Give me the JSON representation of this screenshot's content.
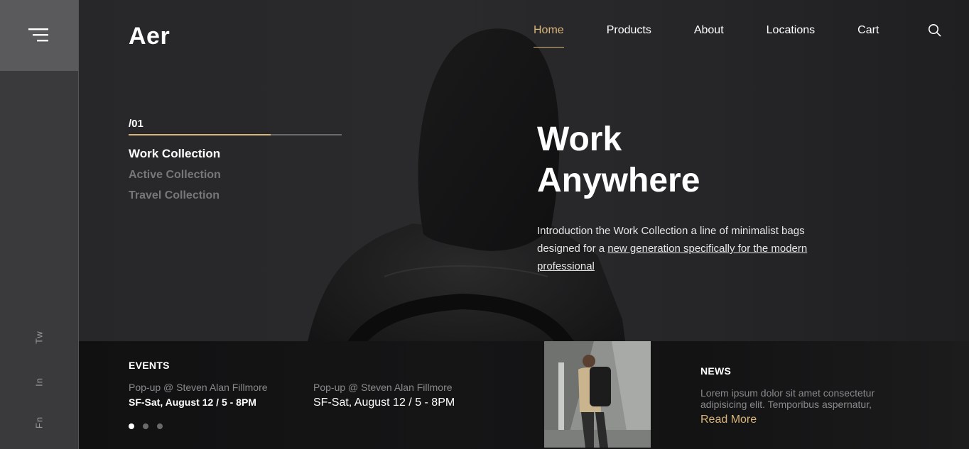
{
  "brand": "Aer",
  "nav": {
    "items": [
      {
        "label": "Home",
        "active": true
      },
      {
        "label": "Products",
        "active": false
      },
      {
        "label": "About",
        "active": false
      },
      {
        "label": "Locations",
        "active": false
      },
      {
        "label": "Cart",
        "active": false
      }
    ]
  },
  "social": {
    "twitter": "Tw",
    "linkedin": "In",
    "facebook": "Fn"
  },
  "slider": {
    "number": "/01",
    "progress_fraction": 0.667,
    "collections": [
      "Work Collection",
      "Active Collection",
      "Travel Collection"
    ],
    "active_index": 0
  },
  "hero": {
    "headline_line1": "Work",
    "headline_line2": "Anywhere",
    "intro_plain": "Introduction the Work Collection a line of minimalist bags designed for a ",
    "intro_link": "new generation specifically for the modern professional"
  },
  "events": {
    "title": "EVENTS",
    "items": [
      {
        "venue": "Pop-up @ Steven Alan Fillmore",
        "date": "SF-Sat, August 12 / 5 - 8PM"
      },
      {
        "venue": "Pop-up @ Steven Alan Fillmore",
        "date": "SF-Sat, August 12 / 5 - 8PM"
      }
    ],
    "dots": 3,
    "active_dot": 0
  },
  "news": {
    "title": "NEWS",
    "text": "Lorem ipsum dolor sit amet consectetur adipisicing elit. Temporibus aspernatur,",
    "read_more": "Read More"
  },
  "colors": {
    "accent": "#d9b57a",
    "background": "#242426",
    "rail": "#3a3a3d"
  }
}
